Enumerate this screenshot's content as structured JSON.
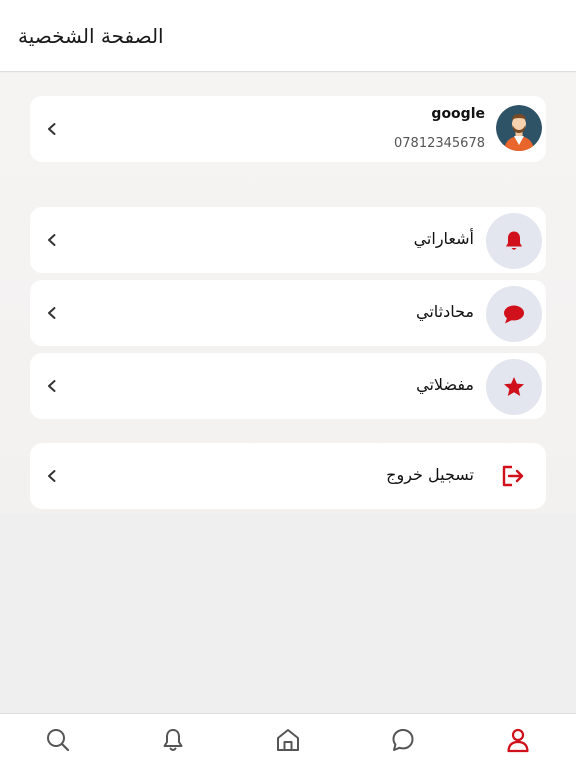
{
  "header": {
    "title": "الصفحة الشخصية"
  },
  "profile": {
    "name": "google",
    "phone": "07812345678"
  },
  "menu": [
    {
      "label": "أشعاراتي",
      "icon": "bell-icon"
    },
    {
      "label": "محادثاتي",
      "icon": "chat-bubble-icon"
    },
    {
      "label": "مفضلاتي",
      "icon": "star-icon"
    }
  ],
  "logout": {
    "label": "تسجيل خروج",
    "icon": "logout-icon"
  },
  "tabbar": {
    "tabs": [
      "search-icon",
      "bell-icon",
      "home-icon",
      "chat-bubble-icon",
      "user-icon"
    ],
    "active": "user-icon"
  },
  "colors": {
    "accent": "#d0111b",
    "icon_bg": "#e3e6ee",
    "inactive": "#555555"
  }
}
